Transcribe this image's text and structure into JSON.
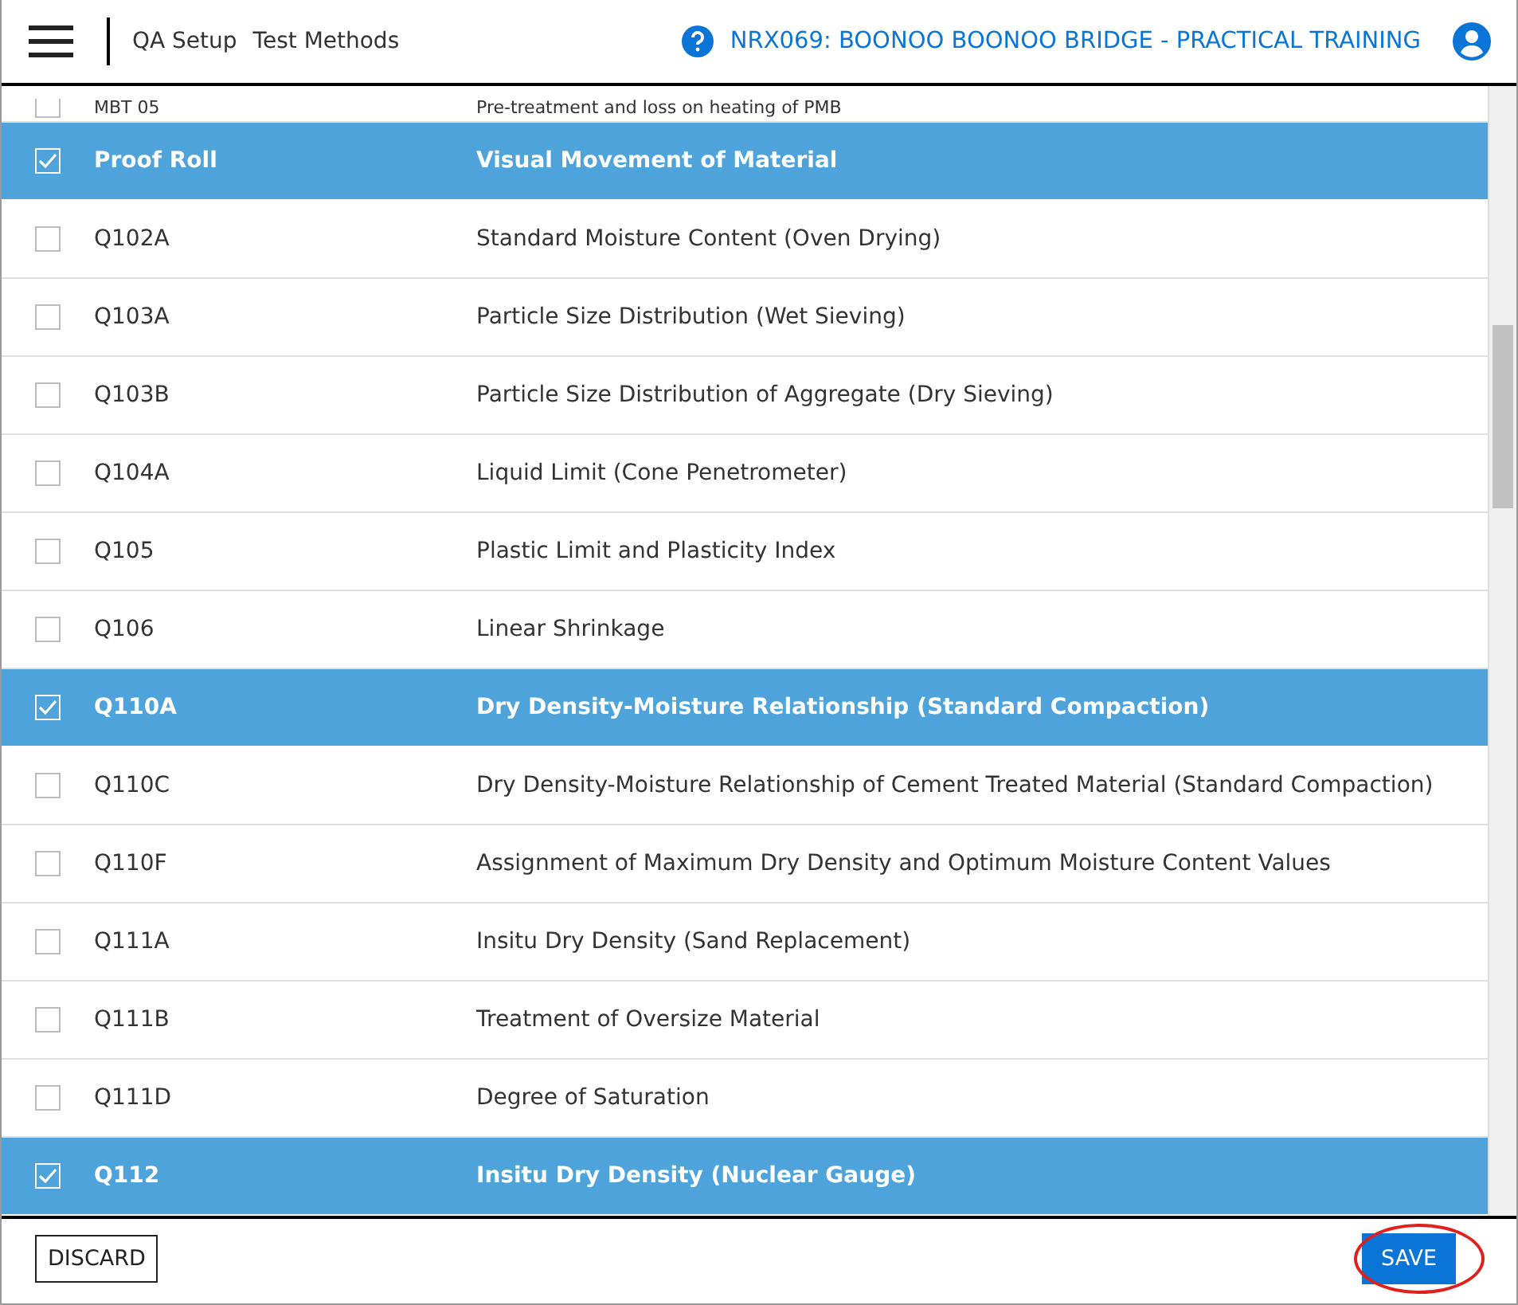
{
  "header": {
    "breadcrumb": [
      "QA Setup",
      "Test Methods"
    ],
    "project": "NRX069: BOONOO BOONOO BRIDGE - PRACTICAL TRAINING"
  },
  "rows": [
    {
      "code": "MBT 05",
      "name": "Pre-treatment and loss on heating of PMB",
      "selected": false,
      "kind": "partial"
    },
    {
      "code": "Proof Roll",
      "name": "Visual Movement of Material",
      "selected": true,
      "kind": "full"
    },
    {
      "code": "Q102A",
      "name": "Standard Moisture Content (Oven Drying)",
      "selected": false,
      "kind": "full"
    },
    {
      "code": "Q103A",
      "name": "Particle Size Distribution (Wet Sieving)",
      "selected": false,
      "kind": "full"
    },
    {
      "code": "Q103B",
      "name": "Particle Size Distribution of Aggregate (Dry Sieving)",
      "selected": false,
      "kind": "full"
    },
    {
      "code": "Q104A",
      "name": "Liquid Limit (Cone Penetrometer)",
      "selected": false,
      "kind": "full"
    },
    {
      "code": "Q105",
      "name": "Plastic Limit and Plasticity Index",
      "selected": false,
      "kind": "full"
    },
    {
      "code": "Q106",
      "name": "Linear Shrinkage",
      "selected": false,
      "kind": "full"
    },
    {
      "code": "Q110A",
      "name": "Dry Density-Moisture Relationship (Standard Compaction)",
      "selected": true,
      "kind": "full"
    },
    {
      "code": "Q110C",
      "name": "Dry Density-Moisture Relationship of Cement Treated Material (Standard Compaction)",
      "selected": false,
      "kind": "full"
    },
    {
      "code": "Q110F",
      "name": "Assignment of Maximum Dry Density and Optimum Moisture Content Values",
      "selected": false,
      "kind": "full"
    },
    {
      "code": "Q111A",
      "name": "Insitu Dry Density (Sand Replacement)",
      "selected": false,
      "kind": "full"
    },
    {
      "code": "Q111B",
      "name": "Treatment of Oversize Material",
      "selected": false,
      "kind": "full"
    },
    {
      "code": "Q111D",
      "name": "Degree of Saturation",
      "selected": false,
      "kind": "full"
    },
    {
      "code": "Q112",
      "name": "Insitu Dry Density (Nuclear Gauge)",
      "selected": true,
      "kind": "full"
    }
  ],
  "footer": {
    "discard": "DISCARD",
    "save": "SAVE",
    "save_highlighted": true
  }
}
